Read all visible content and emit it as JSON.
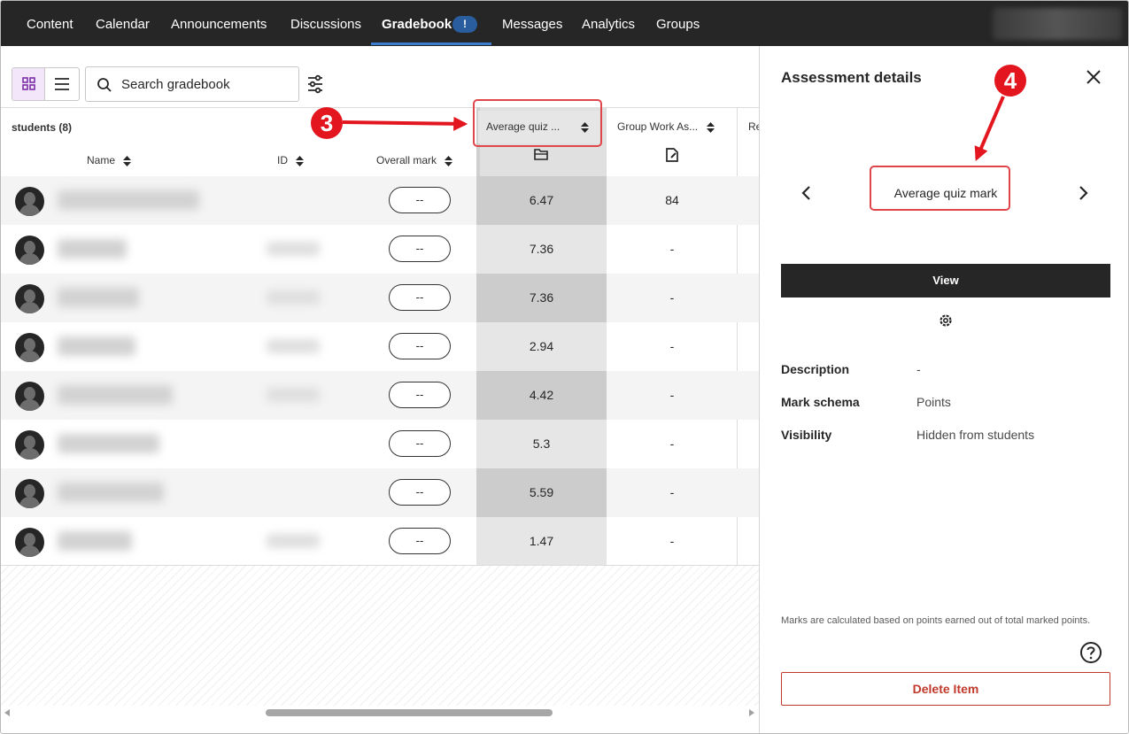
{
  "nav": {
    "tabs": [
      {
        "label": "Content"
      },
      {
        "label": "Calendar"
      },
      {
        "label": "Announcements"
      },
      {
        "label": "Discussions"
      },
      {
        "label": "Gradebook",
        "badge": "!"
      },
      {
        "label": "Messages"
      },
      {
        "label": "Analytics"
      },
      {
        "label": "Groups"
      }
    ],
    "active_tab": "Gradebook"
  },
  "toolbar": {
    "search_placeholder": "Search gradebook"
  },
  "grid": {
    "students_label": "students (8)",
    "columns": {
      "name": "Name",
      "id": "ID",
      "overall": "Overall mark",
      "avg_quiz": "Average quiz ...",
      "group_work": "Group Work As...",
      "next_partial": "Re"
    },
    "rows": [
      {
        "overall": "--",
        "avg_quiz": "6.47",
        "group_work": "84"
      },
      {
        "overall": "--",
        "avg_quiz": "7.36",
        "group_work": "-"
      },
      {
        "overall": "--",
        "avg_quiz": "7.36",
        "group_work": "-"
      },
      {
        "overall": "--",
        "avg_quiz": "2.94",
        "group_work": "-"
      },
      {
        "overall": "--",
        "avg_quiz": "4.42",
        "group_work": "-"
      },
      {
        "overall": "--",
        "avg_quiz": "5.3",
        "group_work": "-"
      },
      {
        "overall": "--",
        "avg_quiz": "5.59",
        "group_work": "-"
      },
      {
        "overall": "--",
        "avg_quiz": "1.47",
        "group_work": "-"
      }
    ]
  },
  "panel": {
    "title": "Assessment details",
    "item_name": "Average quiz mark",
    "view_label": "View",
    "meta": [
      {
        "label": "Description",
        "value": "-"
      },
      {
        "label": "Mark schema",
        "value": "Points"
      },
      {
        "label": "Visibility",
        "value": "Hidden from students"
      }
    ],
    "note": "Marks are calculated based on points earned out of total marked points.",
    "delete_label": "Delete Item"
  },
  "annotations": {
    "step3": "3",
    "step4": "4"
  },
  "colors": {
    "nav_bg": "#262626",
    "nav_underline": "#3b7ed0",
    "badge": "#2a5d9e",
    "highlight": "#e0454a",
    "step_marker": "#e3151f",
    "delete": "#c0392b",
    "view_toggle_active": "#f3e6fb"
  }
}
